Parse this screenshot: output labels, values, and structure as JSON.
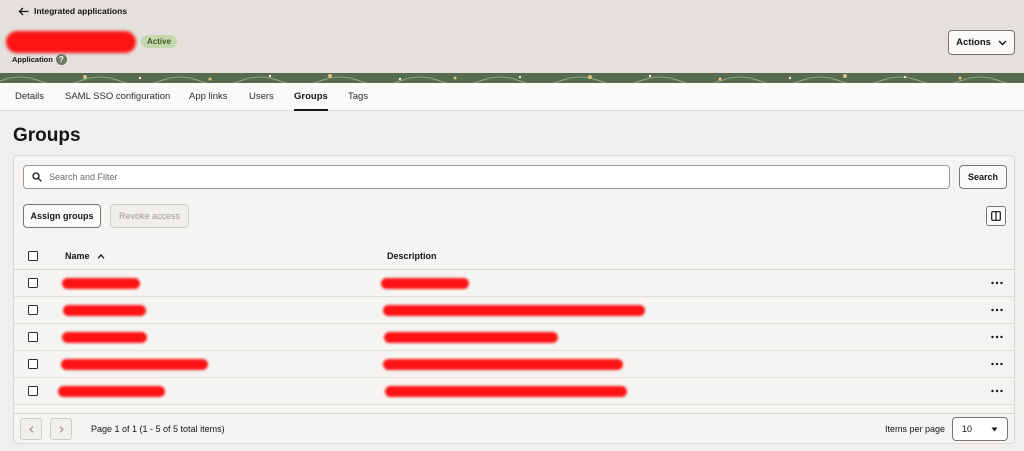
{
  "header": {
    "back_label": "Integrated applications",
    "status": "Active",
    "type_label": "Application",
    "help_glyph": "?",
    "actions_label": "Actions",
    "badge_color": "#c4d8ad"
  },
  "tabs": [
    {
      "label": "Details",
      "active": false
    },
    {
      "label": "SAML SSO configuration",
      "active": false
    },
    {
      "label": "App links",
      "active": false
    },
    {
      "label": "Users",
      "active": false
    },
    {
      "label": "Groups",
      "active": true
    },
    {
      "label": "Tags",
      "active": false
    }
  ],
  "page": {
    "title": "Groups"
  },
  "search": {
    "placeholder": "Search and Filter",
    "value": "",
    "button_label": "Search"
  },
  "toolbar": {
    "assign_label": "Assign groups",
    "revoke_label": "Revoke access"
  },
  "table": {
    "columns": {
      "name": "Name",
      "description": "Description",
      "sort": "ascending"
    },
    "rows": [
      {
        "name": "[redacted]",
        "description": "[redacted]"
      },
      {
        "name": "[redacted]",
        "description": "[redacted]"
      },
      {
        "name": "[redacted]",
        "description": "[redacted]"
      },
      {
        "name": "[redacted]",
        "description": "[redacted]"
      },
      {
        "name": "[redacted]",
        "description": "[redacted]"
      }
    ]
  },
  "pagination": {
    "page_info": "Page 1 of 1 (1 - 5 of 5 total items)",
    "items_per_page_label": "Items per page",
    "items_per_page_value": "10"
  },
  "icons": {
    "back": "arrow-left-icon",
    "help": "help-icon",
    "actions": "chevron-down-icon",
    "search": "search-icon",
    "columns": "columns-icon",
    "sort": "sort-ascending-icon",
    "row_menu": "more-horizontal-icon",
    "prev": "chevron-left-icon",
    "next": "chevron-right-icon"
  },
  "colors": {
    "redaction": "#fc1414",
    "accent": "#161513",
    "banner": "#566b4f"
  }
}
